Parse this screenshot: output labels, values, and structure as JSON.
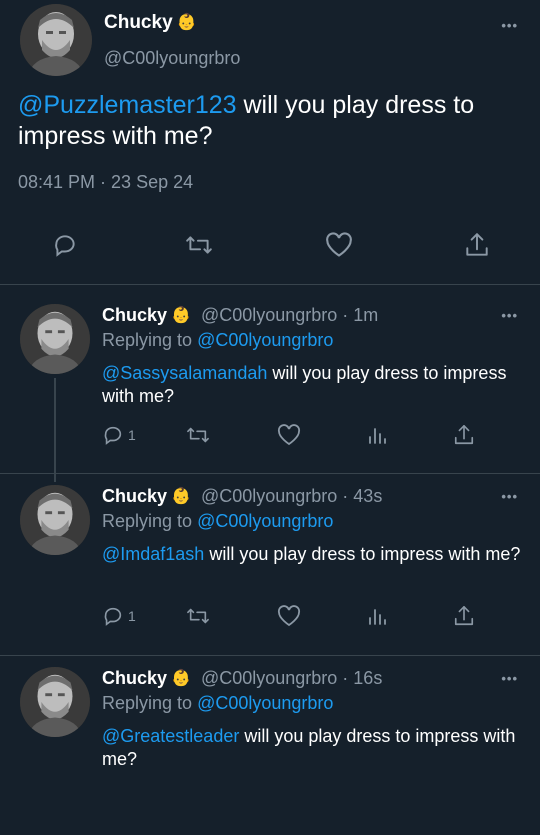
{
  "main_tweet": {
    "name": "Chucky",
    "emoji": "👶",
    "handle": "@C00lyoungrbro",
    "mention": "@Puzzlemaster123",
    "text": " will you play dress to impress with me?",
    "timestamp": "08:41 PM · 23 Sep 24",
    "more": "•••",
    "actions": [
      "reply-icon",
      "retweet-icon",
      "like-icon",
      "share-icon"
    ]
  },
  "replies": [
    {
      "name": "Chucky",
      "emoji": "👶",
      "meta": "@C00lyoungrbro · 1m",
      "replying_prefix": "Replying to ",
      "replying_handle": "@C00lyoungrbro",
      "mention": "@Sassysalamandah",
      "text": " will you play dress to impress with me?",
      "reply_count": "1",
      "more": "•••"
    },
    {
      "name": "Chucky",
      "emoji": "👶",
      "meta": "@C00lyoungrbro · 43s",
      "replying_prefix": "Replying to ",
      "replying_handle": "@C00lyoungrbro",
      "mention": "@Imdaf1ash",
      "text": " will you play dress to impress with me?",
      "reply_count": "1",
      "more": "•••"
    },
    {
      "name": "Chucky",
      "emoji": "👶",
      "meta": "@C00lyoungrbro · 16s",
      "replying_prefix": "Replying to ",
      "replying_handle": "@C00lyoungrbro",
      "mention": "@Greatestleader",
      "text": " will you play dress to impress with me?",
      "more": "•••"
    }
  ],
  "colors": {
    "background": "#15202b",
    "accent": "#1d9bf0",
    "muted": "#8b98a5",
    "divider": "#38444d"
  }
}
